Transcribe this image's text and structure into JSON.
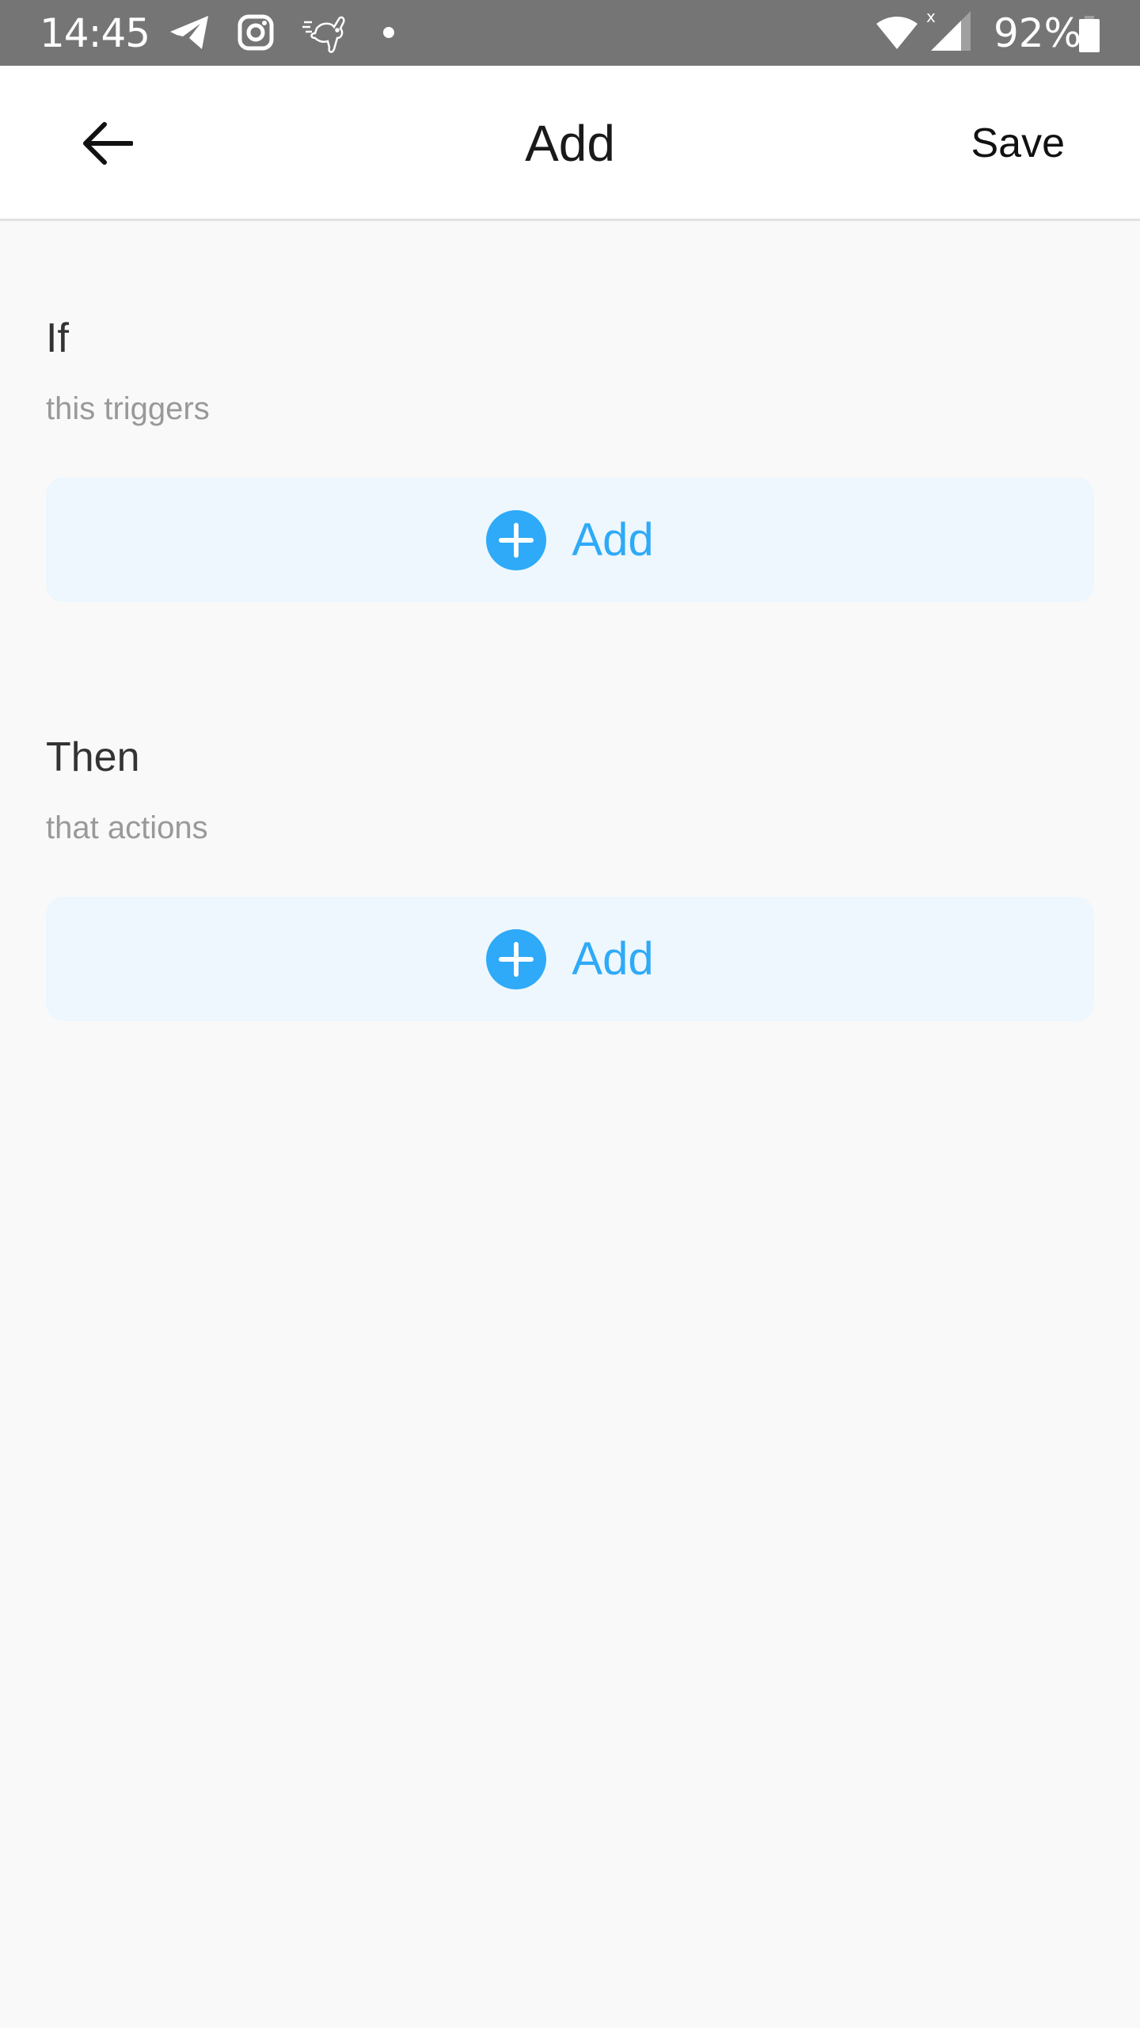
{
  "status_bar": {
    "time": "14:45",
    "notification_icons": [
      "telegram-icon",
      "instagram-icon",
      "rabbit-icon",
      "dot-icon"
    ],
    "system_icons": [
      "wifi-icon",
      "cellular-signal-no-data-icon",
      "battery-icon"
    ],
    "battery_percent": "92%"
  },
  "header": {
    "back_icon": "arrow-left-icon",
    "title": "Add",
    "save_label": "Save"
  },
  "sections": [
    {
      "title": "If",
      "subtitle": "this triggers",
      "add_button": {
        "icon": "plus-circle-icon",
        "label": "Add"
      }
    },
    {
      "title": "Then",
      "subtitle": "that actions",
      "add_button": {
        "icon": "plus-circle-icon",
        "label": "Add"
      }
    }
  ],
  "colors": {
    "accent": "#2eaaf8",
    "card_background": "#eef7fd",
    "page_background": "#f9f9f9",
    "status_bar": "#757575",
    "subtitle_text": "#999999"
  }
}
